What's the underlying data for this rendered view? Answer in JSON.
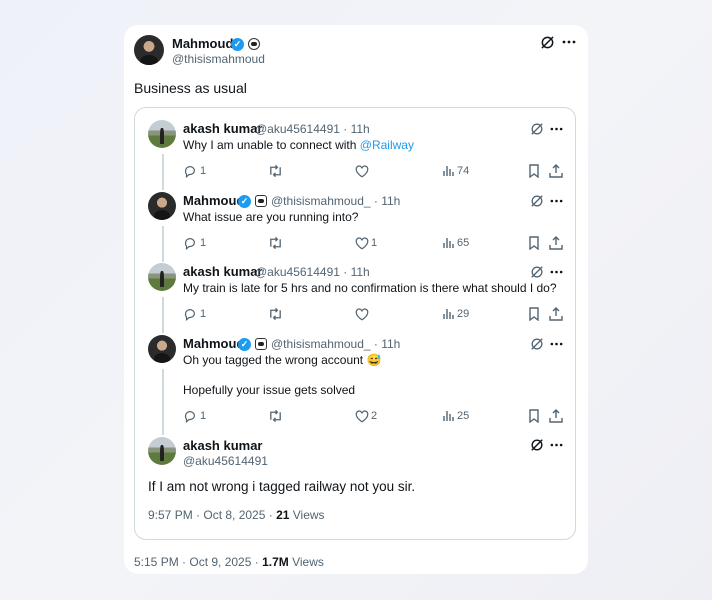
{
  "main_post": {
    "name": "Mahmoud",
    "handle": "@thisismahmoud",
    "text": "Business as usual",
    "time": "5:15 PM · Oct 9, 2025 · ",
    "views_count": "1.7M",
    "views_label": " Views"
  },
  "thread": [
    {
      "name": "akash kumar",
      "handle": "@aku45614491 · 11h",
      "text_before": "Why I am unable to connect with ",
      "mention": "@Railway",
      "replies": "1",
      "retweets": "",
      "likes": "",
      "views": "74"
    },
    {
      "name": "Mahmoud",
      "handle": "@thisismahmoud_ · 11h",
      "text_before": "What issue are you running into?",
      "replies": "1",
      "retweets": "",
      "likes": "1",
      "views": "65"
    },
    {
      "name": "akash kumar",
      "handle": "@aku45614491 · 11h",
      "text_before": "My train is late for 5 hrs and no confirmation is there what should I do?",
      "replies": "1",
      "retweets": "",
      "likes": "",
      "views": "29"
    },
    {
      "name": "Mahmoud",
      "handle": "@thisismahmoud_ · 11h",
      "text_before": "Oh you tagged the wrong account 😅",
      "text_line2": "Hopefully your issue gets solved",
      "replies": "1",
      "retweets": "",
      "likes": "2",
      "views": "25"
    }
  ],
  "final_reply": {
    "name": "akash kumar",
    "handle": "@aku45614491",
    "text": "If I am not wrong i tagged railway not you sir.",
    "time": "9:57 PM · Oct 8, 2025 · ",
    "views_count": "21",
    "views_label": " Views"
  },
  "icons": {
    "verified": "verified-check-icon",
    "affiliate": "affiliate-badge-icon",
    "grok": "grok-icon",
    "more": "more-icon",
    "reply": "reply-icon",
    "retweet": "retweet-icon",
    "like": "like-icon",
    "views": "views-icon",
    "bookmark": "bookmark-icon",
    "share": "share-icon"
  },
  "colors": {
    "accent": "#1d9bf0",
    "muted": "#536471",
    "text": "#0f1419"
  }
}
